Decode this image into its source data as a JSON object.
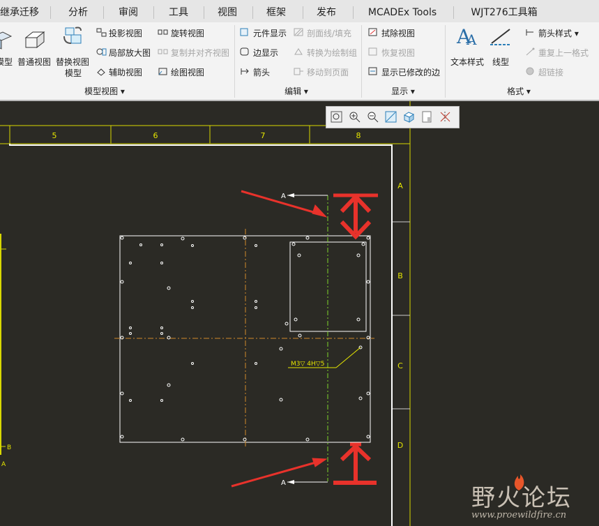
{
  "ribbon": {
    "tabs": [
      "继承迁移",
      "分析",
      "审阅",
      "工具",
      "视图",
      "框架",
      "发布",
      "MCADEx Tools",
      "WJT276工具箱"
    ],
    "model_view": {
      "large": [
        "模型",
        "普通视图",
        "替换视图",
        "模型"
      ],
      "items": [
        "投影视图",
        "局部放大图",
        "辅助视图",
        "旋转视图",
        "复制并对齐视图",
        "绘图视图"
      ],
      "group": "模型视图 ▾"
    },
    "edit": {
      "items": [
        "元件显示",
        "边显示",
        "箭头",
        "剖面线/填充",
        "转换为绘制组",
        "移动到页面"
      ],
      "group": "编辑 ▾"
    },
    "display": {
      "items": [
        "拭除视图",
        "恢复视图",
        "显示已修改的边"
      ],
      "group": "显示 ▾"
    },
    "format": {
      "large": [
        "文本样式",
        "线型"
      ],
      "items": [
        "箭头样式 ▾",
        "重复上一格式",
        "超链接"
      ],
      "group": "格式 ▾"
    }
  },
  "view_toolbar": {
    "icons": [
      "refit-icon",
      "zoom-in-icon",
      "zoom-out-icon",
      "repaint-icon",
      "display-style-icon",
      "sheet-icon",
      "datum-display-icon"
    ]
  },
  "drawing": {
    "column_labels": [
      "5",
      "6",
      "7",
      "8"
    ],
    "row_labels": [
      "A",
      "B",
      "C",
      "D"
    ],
    "section_label_top": "A",
    "section_label_bottom": "A",
    "hole_note": "M3▽ 4H▽5",
    "left_label_b": "B",
    "left_label_a": "A"
  },
  "watermark": {
    "title": "野火论坛",
    "url": "www.proewildfire.cn"
  }
}
